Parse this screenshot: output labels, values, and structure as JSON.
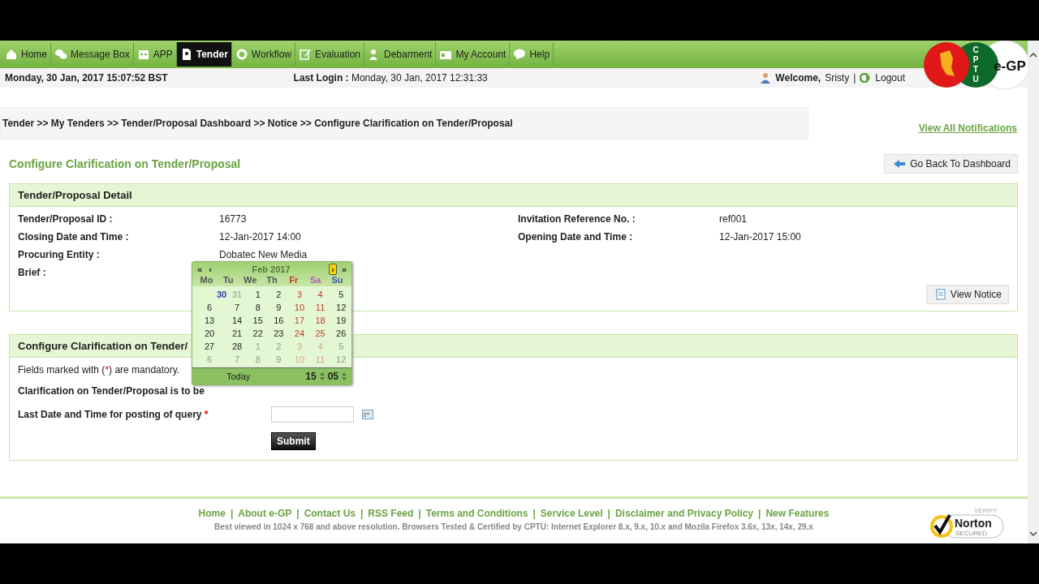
{
  "nav": [
    {
      "label": "Home",
      "selected": false
    },
    {
      "label": "Message Box",
      "selected": false
    },
    {
      "label": "APP",
      "selected": false
    },
    {
      "label": "Tender",
      "selected": true
    },
    {
      "label": "Workflow",
      "selected": false
    },
    {
      "label": "Evaluation",
      "selected": false
    },
    {
      "label": "Debarment",
      "selected": false
    },
    {
      "label": "My Account",
      "selected": false
    },
    {
      "label": "Help",
      "selected": false
    }
  ],
  "logo": {
    "cptu": [
      "C",
      "P",
      "T",
      "U"
    ],
    "egp": "e-GP"
  },
  "info_bar": {
    "datetime": "Monday, 30 Jan, 2017 15:07:52 BST",
    "last_login_label": "Last Login :",
    "last_login": "Monday, 30 Jan, 2017 12:31:33",
    "welcome": "Welcome,",
    "user": "Sristy",
    "separator": "|",
    "logout": "Logout"
  },
  "breadcrumb": "Tender >> My Tenders >> Tender/Proposal Dashboard >> Notice >> Configure Clarification on Tender/Proposal",
  "view_all": "View All Notifications",
  "page_title": "Configure Clarification on Tender/Proposal",
  "back_button": "Go Back To Dashboard",
  "detail": {
    "title": "Tender/Proposal Detail",
    "left": [
      {
        "label": "Tender/Proposal ID :",
        "value": "16773"
      },
      {
        "label": "Closing Date and Time :",
        "value": "12-Jan-2017 14:00"
      },
      {
        "label": "Procuring Entity :",
        "value": "Dobatec New Media"
      },
      {
        "label": "Brief :"
      }
    ],
    "right": [
      {
        "label": "Invitation Reference No. :",
        "value": "ref001"
      },
      {
        "label": "Opening Date and Time :",
        "value": "12-Jan-2017 15:00"
      }
    ],
    "view_notice": "View Notice"
  },
  "configure": {
    "title": "Configure Clarification on Tender/",
    "mandatory_pre": "Fields marked with (",
    "mandatory_star": "*",
    "mandatory_post": ") are mandatory.",
    "clarification": "Clarification on Tender/Proposal is to be",
    "last_date_label": "Last Date and Time for posting of query",
    "required": "*",
    "submit": "Submit"
  },
  "calendar": {
    "month": "Feb 2017",
    "prev_year": "«",
    "prev": "‹",
    "next": "›",
    "next_year": "»",
    "weekdays": [
      {
        "label": "Mo",
        "color": "#555555"
      },
      {
        "label": "Tu",
        "color": "#555555"
      },
      {
        "label": "We",
        "color": "#555555"
      },
      {
        "label": "Th",
        "color": "#555555"
      },
      {
        "label": "Fr",
        "color": "#c0392b"
      },
      {
        "label": "Sa",
        "color": "#b05cc0"
      },
      {
        "label": "Su",
        "color": "#4a5aa8"
      }
    ],
    "days": [
      {
        "d": "30",
        "kind": "today"
      },
      {
        "d": "31",
        "kind": "other"
      },
      {
        "d": "1",
        "kind": "day"
      },
      {
        "d": "2",
        "kind": "day"
      },
      {
        "d": "3",
        "kind": "day"
      },
      {
        "d": "4",
        "kind": "day"
      },
      {
        "d": "5",
        "kind": "day"
      },
      {
        "d": "6",
        "kind": "day"
      },
      {
        "d": "7",
        "kind": "day"
      },
      {
        "d": "8",
        "kind": "day"
      },
      {
        "d": "9",
        "kind": "day"
      },
      {
        "d": "10",
        "kind": "day"
      },
      {
        "d": "11",
        "kind": "day"
      },
      {
        "d": "12",
        "kind": "day"
      },
      {
        "d": "13",
        "kind": "day"
      },
      {
        "d": "14",
        "kind": "day"
      },
      {
        "d": "15",
        "kind": "day"
      },
      {
        "d": "16",
        "kind": "day"
      },
      {
        "d": "17",
        "kind": "day"
      },
      {
        "d": "18",
        "kind": "day"
      },
      {
        "d": "19",
        "kind": "day"
      },
      {
        "d": "20",
        "kind": "day"
      },
      {
        "d": "21",
        "kind": "day"
      },
      {
        "d": "22",
        "kind": "day"
      },
      {
        "d": "23",
        "kind": "day"
      },
      {
        "d": "24",
        "kind": "day"
      },
      {
        "d": "25",
        "kind": "day"
      },
      {
        "d": "26",
        "kind": "day"
      },
      {
        "d": "27",
        "kind": "day"
      },
      {
        "d": "28",
        "kind": "day"
      },
      {
        "d": "1",
        "kind": "other"
      },
      {
        "d": "2",
        "kind": "other"
      },
      {
        "d": "3",
        "kind": "other"
      },
      {
        "d": "4",
        "kind": "other"
      },
      {
        "d": "5",
        "kind": "other"
      },
      {
        "d": "6",
        "kind": "other"
      },
      {
        "d": "7",
        "kind": "other"
      },
      {
        "d": "8",
        "kind": "other"
      },
      {
        "d": "9",
        "kind": "other"
      },
      {
        "d": "10",
        "kind": "other"
      },
      {
        "d": "11",
        "kind": "other"
      },
      {
        "d": "12",
        "kind": "other"
      }
    ],
    "today": "Today",
    "hour": "15",
    "minute": "05"
  },
  "footer": {
    "links": [
      "Home",
      "About e-GP",
      "Contact Us",
      "RSS Feed",
      "Terms and Conditions",
      "Service Level",
      "Disclaimer and Privacy Policy",
      "New Features"
    ],
    "separator": "|",
    "note": "Best viewed in 1024 x 768 and above resolution. Browsers Tested & Certified by CPTU: Internet Explorer 8.x, 9.x, 10.x and Mozila Firefox 3.6x, 13x, 14x, 29.x",
    "norton": {
      "verify": "VERIFY",
      "name": "Norton",
      "secured": "SECURED"
    }
  }
}
